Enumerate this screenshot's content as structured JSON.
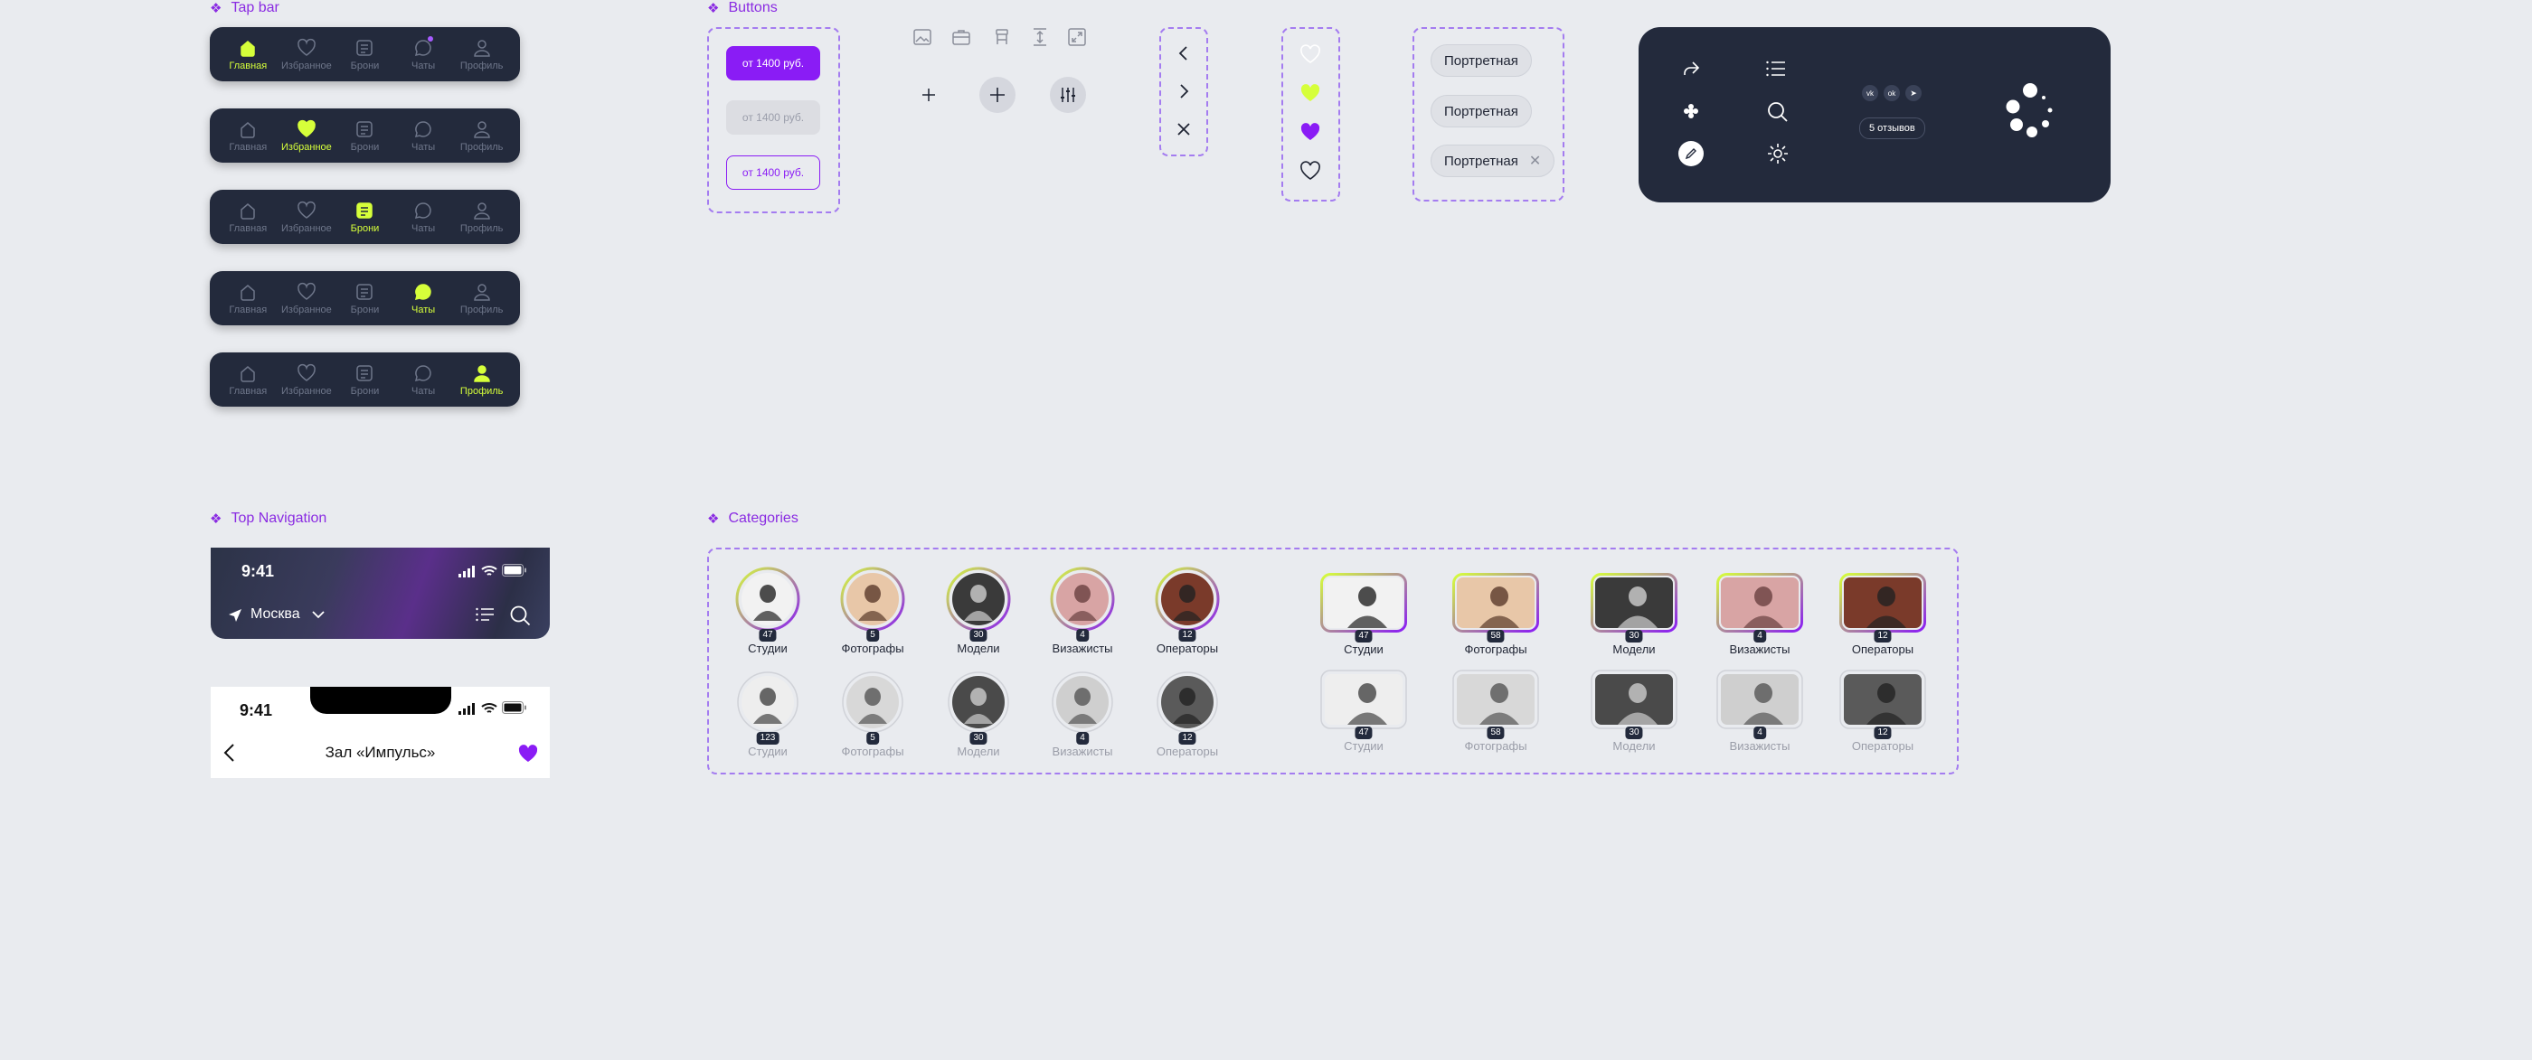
{
  "sections": {
    "tap_bar": "Tap bar",
    "buttons": "Buttons",
    "top_navigation": "Top Navigation",
    "categories": "Categories"
  },
  "tab_labels": [
    "Главная",
    "Избранное",
    "Брони",
    "Чаты",
    "Профиль"
  ],
  "colors": {
    "accent": "#8a1cf5",
    "active_tab": "#d6ff3a",
    "dark_bg": "#232a3c",
    "page_bg": "#e9ebef"
  },
  "buttons": {
    "primary": "от 1400 руб.",
    "disabled": "от 1400 руб.",
    "outline": "от 1400 руб."
  },
  "chips": [
    "Портретная",
    "Портретная",
    "Портретная"
  ],
  "dark_card": {
    "reviews": "5 отзывов",
    "socials": [
      "vk",
      "ok",
      "tg"
    ]
  },
  "top_nav": {
    "time": "9:41",
    "city": "Москва",
    "time_light": "9:41",
    "title": "Зал «Импульс»"
  },
  "categories": {
    "round": [
      {
        "label": "Студии",
        "count": "47"
      },
      {
        "label": "Фотографы",
        "count": "5"
      },
      {
        "label": "Модели",
        "count": "30"
      },
      {
        "label": "Визажисты",
        "count": "4"
      },
      {
        "label": "Операторы",
        "count": "12"
      }
    ],
    "round_gray": [
      {
        "label": "Студии",
        "count": "123"
      },
      {
        "label": "Фотографы",
        "count": "5"
      },
      {
        "label": "Модели",
        "count": "30"
      },
      {
        "label": "Визажисты",
        "count": "4"
      },
      {
        "label": "Операторы",
        "count": "12"
      }
    ],
    "square": [
      {
        "label": "Студии",
        "count": "47"
      },
      {
        "label": "Фотографы",
        "count": "58"
      },
      {
        "label": "Модели",
        "count": "30"
      },
      {
        "label": "Визажисты",
        "count": "4"
      },
      {
        "label": "Операторы",
        "count": "12"
      }
    ],
    "square_gray": [
      {
        "label": "Студии",
        "count": "47"
      },
      {
        "label": "Фотографы",
        "count": "58"
      },
      {
        "label": "Модели",
        "count": "30"
      },
      {
        "label": "Визажисты",
        "count": "4"
      },
      {
        "label": "Операторы",
        "count": "12"
      }
    ]
  }
}
